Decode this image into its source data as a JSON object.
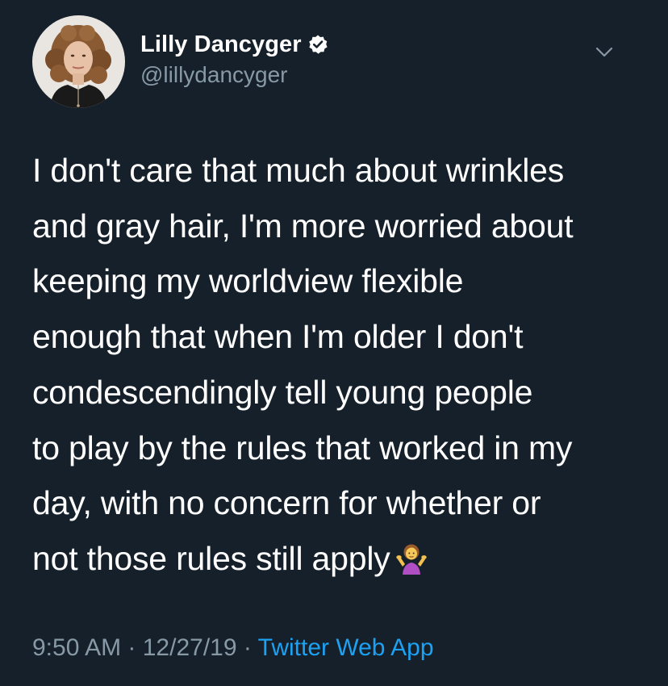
{
  "user": {
    "display_name": "Lilly Dancyger",
    "handle": "@lillydancyger",
    "verified": true
  },
  "icons": {
    "avatar": "profile-photo",
    "verified": "verified-badge-icon",
    "menu": "chevron-down-icon",
    "emoji": "person-shrugging-emoji"
  },
  "tweet": {
    "lines": [
      "I don't care that much about wrinkles",
      "and gray hair, I'm more worried about",
      "keeping my worldview flexible",
      "enough that when I'm older I don't",
      "condescendingly tell young people",
      "to play by the rules that worked in my",
      "day, with no concern for whether or",
      "not those rules still apply"
    ]
  },
  "meta": {
    "time": "9:50 AM",
    "separator1": " · ",
    "date": "12/27/19",
    "separator2": " · ",
    "source": "Twitter Web App"
  },
  "colors": {
    "background": "#15202b",
    "primary_text": "#ffffff",
    "secondary_text": "#8899a6",
    "link": "#1da1f2"
  }
}
